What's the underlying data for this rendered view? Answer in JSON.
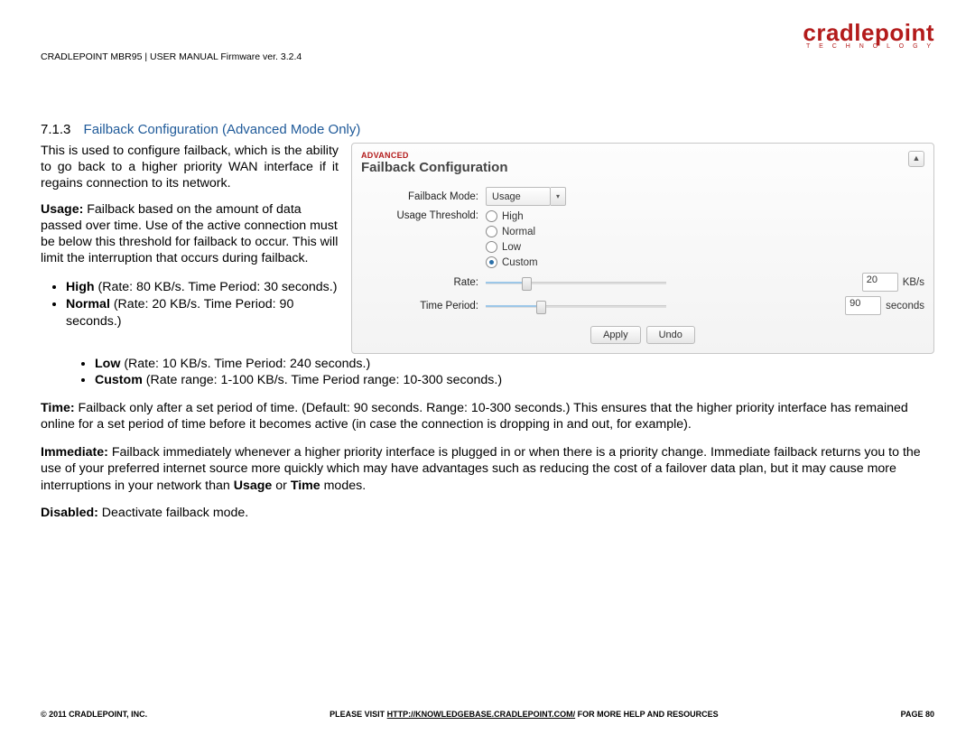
{
  "header": {
    "doc_id": "CRADLEPOINT MBR95 | USER MANUAL Firmware ver. 3.2.4",
    "logo_brand": "cradlepoint",
    "logo_tag": "T E C H N O L O G Y"
  },
  "heading": {
    "num": "7.1.3",
    "title": "Failback Configuration (Advanced Mode Only)"
  },
  "text": {
    "intro": "This is used to configure failback, which is the ability to go back to a higher priority WAN interface if it regains connection to its network.",
    "usage_b": "Usage:",
    "usage": " Failback based on the amount of data passed over time. Use of the active connection must be below this threshold for failback to occur. This will limit the interruption that occurs during failback.",
    "li_high_b": "High",
    "li_high": " (Rate: 80 KB/s. Time Period: 30 seconds.)",
    "li_norm_b": "Normal",
    "li_norm": " (Rate: 20 KB/s. Time Period: 90 seconds.)",
    "li_low_b": "Low",
    "li_low": " (Rate: 10 KB/s. Time Period: 240 seconds.)",
    "li_cust_b": "Custom",
    "li_cust": " (Rate range: 1-100 KB/s. Time Period range: 10-300 seconds.)",
    "time_b": "Time:",
    "time": " Failback only after a set period of time. (Default: 90 seconds. Range: 10-300 seconds.) This ensures that the higher priority interface has remained online for a set period of time before it becomes active (in case the connection is dropping in and out, for example).",
    "imm_b": "Immediate:",
    "imm1": " Failback immediately whenever a higher priority interface is plugged in or when there is a priority change. Immediate failback returns you to the use of your preferred internet source more quickly which may have advantages such as reducing the cost of a failover data plan, but it may cause more interruptions in your network than ",
    "imm_u1": "Usage",
    "imm2": " or ",
    "imm_u2": "Time",
    "imm3": " modes.",
    "dis_b": "Disabled:",
    "dis": " Deactivate failback mode."
  },
  "panel": {
    "adv": "ADVANCED",
    "title": "Failback Configuration",
    "labels": {
      "mode": "Failback Mode:",
      "threshold": "Usage Threshold:",
      "rate": "Rate:",
      "period": "Time Period:"
    },
    "mode_value": "Usage",
    "radio": {
      "high": "High",
      "normal": "Normal",
      "low": "Low",
      "custom": "Custom"
    },
    "rate_value": "20",
    "rate_unit": "KB/s",
    "period_value": "90",
    "period_unit": "seconds",
    "buttons": {
      "apply": "Apply",
      "undo": "Undo"
    },
    "collapse": "▲"
  },
  "footer": {
    "left": "© 2011 CRADLEPOINT, INC.",
    "mid_pre": "PLEASE VISIT ",
    "mid_link": "HTTP://KNOWLEDGEBASE.CRADLEPOINT.COM/",
    "mid_post": " FOR MORE HELP AND RESOURCES",
    "right": "PAGE 80"
  }
}
